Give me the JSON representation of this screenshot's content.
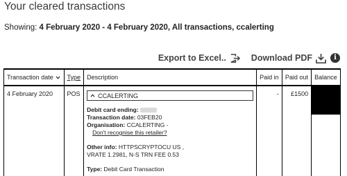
{
  "page": {
    "title": "Your cleared transactions",
    "showing_prefix": "Showing:",
    "showing_value": "4 February 2020 - 4 February 2020, All transactions, ccalerting"
  },
  "toolbar": {
    "export_excel_label": "Export to Excel..",
    "download_pdf_label": "Download PDF",
    "icons": [
      "export-icon",
      "download-icon",
      "info-icon"
    ]
  },
  "table": {
    "headers": {
      "date": "Transaction date",
      "type": "Type",
      "description": "Description",
      "paid_in": "Paid in",
      "paid_out": "Paid out",
      "balance": "Balance"
    },
    "row": {
      "date": "4 February 2020",
      "type": "POS",
      "description": "CCALERTING",
      "paid_in": "-",
      "paid_out": "£1500",
      "detail": {
        "card_label": "Debit card ending:",
        "txdate_label": "Transaction date:",
        "txdate_value": "03FEB20",
        "org_label": "Organisation:",
        "org_value": "CCALERTING -",
        "retailer_link": "Don't recognise this retailer?",
        "other_label": "Other info:",
        "other_value_line1": "HTTPSCRYPTOCU US ,",
        "other_value_line2": "VRATE 1.2981, N-S TRN FEE 0.53",
        "type_label": "Type:",
        "type_value": "Debit Card Transaction"
      }
    }
  },
  "colors": {
    "balance_redaction": "#000000",
    "text": "#222222"
  }
}
